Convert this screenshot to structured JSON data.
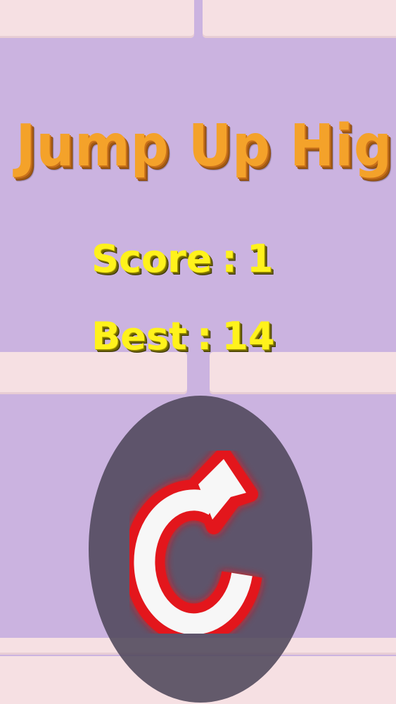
{
  "game": {
    "title": "Jump Up High",
    "score_label": "Score",
    "score_value": "1",
    "best_label": "Best",
    "best_value": "14",
    "separator": ":"
  },
  "controls": {
    "restart_icon": "restart-arrow-icon"
  },
  "colors": {
    "background": "#cbb3e0",
    "brick": "#f6e0e3",
    "title": "#f4a22a",
    "score_text": "#fff21c",
    "restart_button": "#4f475a",
    "restart_glow": "#e3141c",
    "restart_arrow": "#f7f7f7"
  }
}
